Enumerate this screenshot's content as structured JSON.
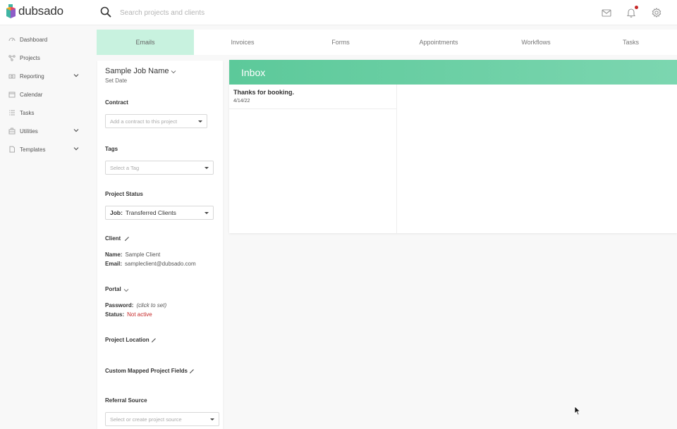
{
  "app": {
    "name": "dubsado"
  },
  "search": {
    "placeholder": "Search projects and clients"
  },
  "sidebar": {
    "items": [
      {
        "label": "Dashboard",
        "icon": "dashboard-icon"
      },
      {
        "label": "Projects",
        "icon": "projects-icon"
      },
      {
        "label": "Reporting",
        "icon": "reporting-icon",
        "expandable": true
      },
      {
        "label": "Calendar",
        "icon": "calendar-icon"
      },
      {
        "label": "Tasks",
        "icon": "tasks-icon"
      },
      {
        "label": "Utilities",
        "icon": "utilities-icon",
        "expandable": true
      },
      {
        "label": "Templates",
        "icon": "templates-icon",
        "expandable": true
      }
    ]
  },
  "tabs": [
    {
      "label": "Emails",
      "active": true
    },
    {
      "label": "Invoices"
    },
    {
      "label": "Forms"
    },
    {
      "label": "Appointments"
    },
    {
      "label": "Workflows"
    },
    {
      "label": "Tasks"
    }
  ],
  "project": {
    "name": "Sample Job Name",
    "set_date": "Set Date",
    "contract": {
      "title": "Contract",
      "placeholder": "Add a contract to this project"
    },
    "tags": {
      "title": "Tags",
      "placeholder": "Select a Tag"
    },
    "status": {
      "title": "Project Status",
      "prefix": "Job:",
      "value": "Transferred Clients"
    },
    "client": {
      "title": "Client",
      "name_label": "Name:",
      "name_value": "Sample Client",
      "email_label": "Email:",
      "email_value": "sampleclient@dubsado.com"
    },
    "portal": {
      "title": "Portal",
      "password_label": "Password:",
      "password_value": "(click to set)",
      "status_label": "Status:",
      "status_value": "Not active"
    },
    "location": {
      "title": "Project Location"
    },
    "custom_fields": {
      "title": "Custom Mapped Project Fields"
    },
    "referral": {
      "title": "Referral Source",
      "placeholder": "Select or create project source"
    }
  },
  "inbox": {
    "title": "Inbox",
    "messages": [
      {
        "subject": "Thanks for booking.",
        "date": "4/14/22"
      }
    ]
  },
  "colors": {
    "accent": "#5cc99a",
    "active_tab": "#c8f2df",
    "alert": "#c62828"
  }
}
